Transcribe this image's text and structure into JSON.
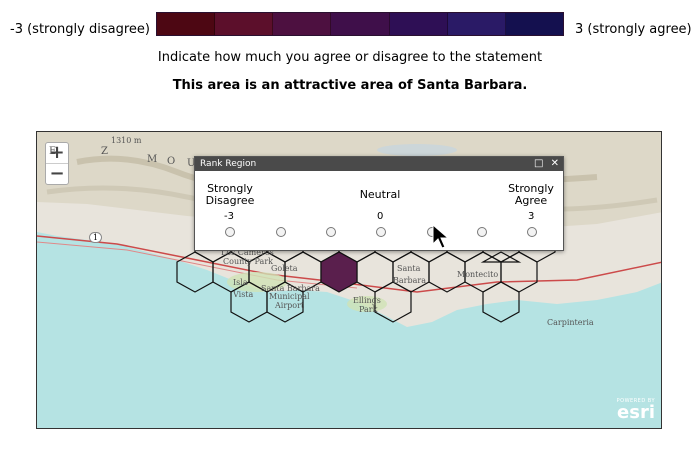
{
  "legend": {
    "min_label": "-3 (strongly disagree)",
    "max_label": "3 (strongly agree)",
    "colors": [
      "#4d0713",
      "#5c0f2b",
      "#4d1040",
      "#3f0f4a",
      "#2e0f55",
      "#2a1a66",
      "#14104f"
    ]
  },
  "instruction": "Indicate how much you agree or disagree to the statement",
  "statement": "This area is an attractive area of Santa Barbara.",
  "map": {
    "zoom_in": "+",
    "zoom_out": "−",
    "labels": {
      "elevation": "1310 m",
      "letter_e": "E",
      "letter_z": "Z",
      "letter_m": "M",
      "letter_o": "O",
      "letter_u": "U",
      "route": "1",
      "los_cameros": "Los Cameros",
      "county_park": "County Park",
      "goleta": "Goleta",
      "isla": "Isla",
      "vista": "Vista",
      "santa_barbara_airport": "Santa Barbara",
      "municipal": "Municipal",
      "airport": "Airport",
      "ellings": "Ellings",
      "park": "Park",
      "santa": "Santa",
      "barbara": "Barbara",
      "montecito": "Montecito",
      "carpinteria": "Carpinteria"
    },
    "attribution_small": "POWERED BY",
    "attribution_brand": "esri",
    "selected_hex_color": "#5a1f4d"
  },
  "popup": {
    "title": "Rank Region",
    "maximize_icon": "□",
    "close_icon": "✕",
    "left_label_line1": "Strongly",
    "left_label_line2": "Disagree",
    "center_label": "Neutral",
    "right_label_line1": "Strongly",
    "right_label_line2": "Agree",
    "value_min": "-3",
    "value_mid": "0",
    "value_max": "3",
    "options": [
      -3,
      -2,
      -1,
      0,
      1,
      2,
      3
    ]
  }
}
